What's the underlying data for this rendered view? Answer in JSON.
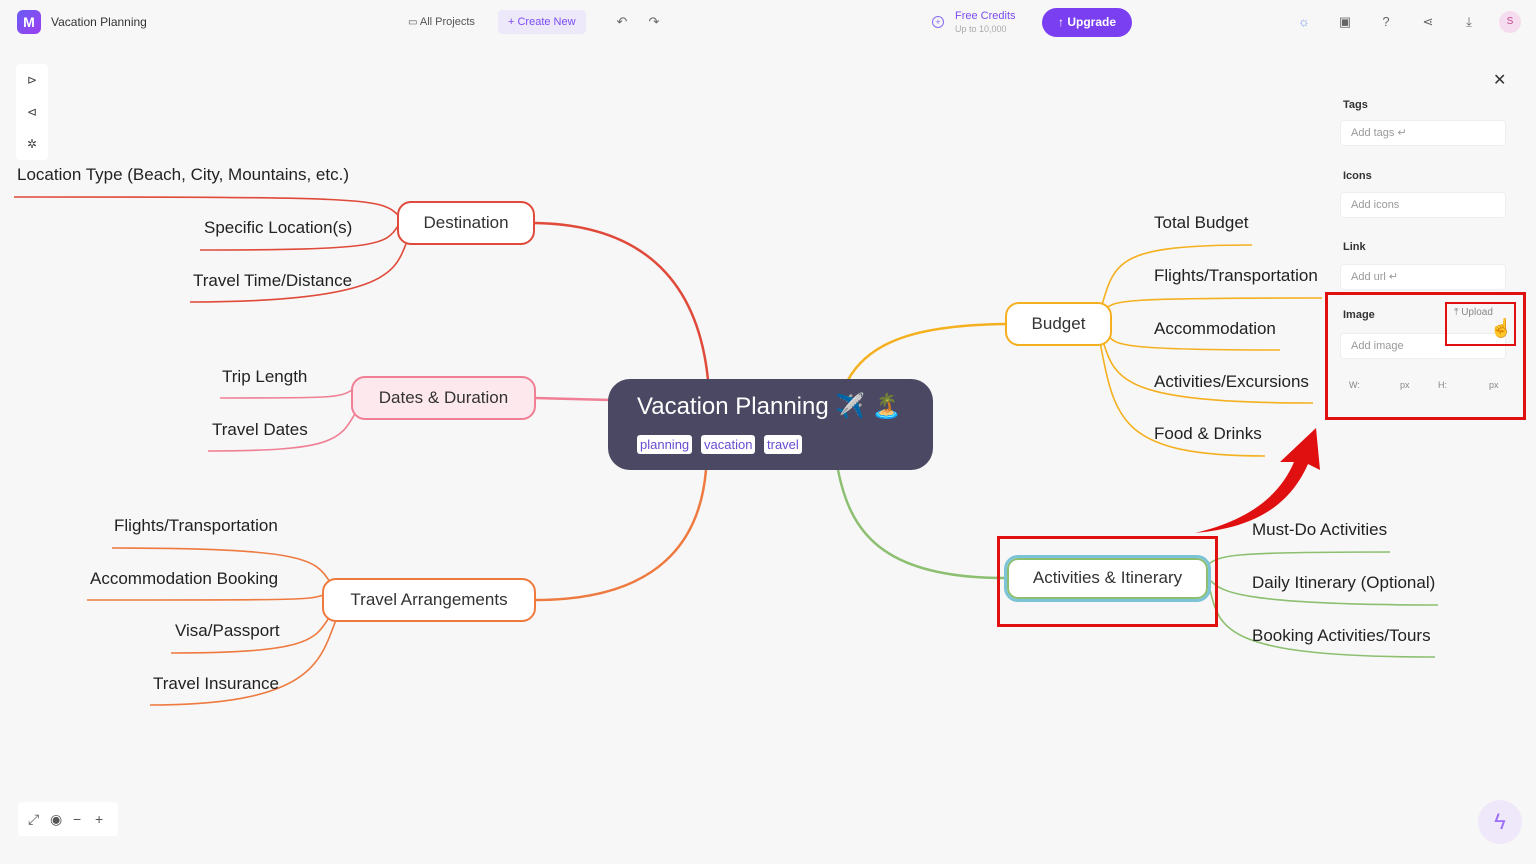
{
  "header": {
    "logo_text": "M",
    "title": "Vacation Planning",
    "all_projects": "All Projects",
    "create_new": "+ Create New",
    "credits_title": "Free Credits",
    "credits_sub": "Up to 10,000",
    "upgrade": "↑ Upgrade",
    "avatar": "S"
  },
  "mindmap": {
    "root": {
      "title": "Vacation Planning ✈️ 🏝️",
      "tags": [
        "planning",
        "vacation",
        "travel"
      ]
    },
    "branches": [
      {
        "label": "Destination",
        "color": "#e04a3a",
        "children": [
          "Location Type (Beach, City, Mountains, etc.)",
          "Specific Location(s)",
          "Travel Time/Distance"
        ]
      },
      {
        "label": "Dates & Duration",
        "color": "#f07f95",
        "children": [
          "Trip Length",
          "Travel Dates"
        ]
      },
      {
        "label": "Travel Arrangements",
        "color": "#ee7a40",
        "children": [
          "Flights/Transportation",
          "Accommodation Booking",
          "Visa/Passport",
          "Travel Insurance"
        ]
      },
      {
        "label": "Budget",
        "color": "#f5b020",
        "children": [
          "Total Budget",
          "Flights/Transportation",
          "Accommodation",
          "Activities/Excursions",
          "Food & Drinks"
        ]
      },
      {
        "label": "Activities & Itinerary",
        "color": "#8cbf70",
        "children": [
          "Must-Do Activities",
          "Daily Itinerary (Optional)",
          "Booking Activities/Tours"
        ]
      }
    ]
  },
  "panel": {
    "tags_label": "Tags",
    "tags_placeholder": "Add tags ↵",
    "icons_label": "Icons",
    "icons_placeholder": "Add icons",
    "link_label": "Link",
    "link_placeholder": "Add url ↵",
    "image_label": "Image",
    "upload_label": "Upload",
    "image_placeholder": "Add image",
    "width_label": "W:",
    "width_unit": "px",
    "height_label": "H:",
    "height_unit": "px"
  },
  "colors": {
    "accent": "#7b3ff2",
    "annotation": "#e01010"
  }
}
